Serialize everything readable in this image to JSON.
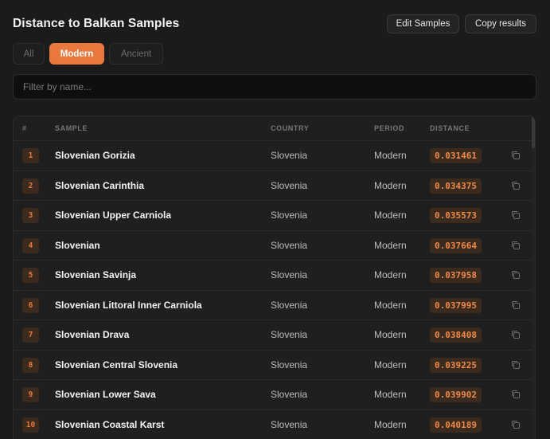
{
  "header": {
    "title": "Distance to Balkan Samples"
  },
  "toolbar": {
    "edit_label": "Edit Samples",
    "copy_label": "Copy results"
  },
  "filters": {
    "all": "All",
    "modern": "Modern",
    "ancient": "Ancient",
    "active": "Modern"
  },
  "search": {
    "placeholder": "Filter by name..."
  },
  "table": {
    "columns": [
      "#",
      "SAMPLE",
      "COUNTRY",
      "PERIOD",
      "DISTANCE"
    ],
    "rows": [
      {
        "rank": "1",
        "sample": "Slovenian Gorizia",
        "country": "Slovenia",
        "period": "Modern",
        "distance": "0.031461"
      },
      {
        "rank": "2",
        "sample": "Slovenian Carinthia",
        "country": "Slovenia",
        "period": "Modern",
        "distance": "0.034375"
      },
      {
        "rank": "3",
        "sample": "Slovenian Upper Carniola",
        "country": "Slovenia",
        "period": "Modern",
        "distance": "0.035573"
      },
      {
        "rank": "4",
        "sample": "Slovenian",
        "country": "Slovenia",
        "period": "Modern",
        "distance": "0.037664"
      },
      {
        "rank": "5",
        "sample": "Slovenian Savinja",
        "country": "Slovenia",
        "period": "Modern",
        "distance": "0.037958"
      },
      {
        "rank": "6",
        "sample": "Slovenian Littoral Inner Carniola",
        "country": "Slovenia",
        "period": "Modern",
        "distance": "0.037995"
      },
      {
        "rank": "7",
        "sample": "Slovenian Drava",
        "country": "Slovenia",
        "period": "Modern",
        "distance": "0.038408"
      },
      {
        "rank": "8",
        "sample": "Slovenian Central Slovenia",
        "country": "Slovenia",
        "period": "Modern",
        "distance": "0.039225"
      },
      {
        "rank": "9",
        "sample": "Slovenian Lower Sava",
        "country": "Slovenia",
        "period": "Modern",
        "distance": "0.039902"
      },
      {
        "rank": "10",
        "sample": "Slovenian Coastal Karst",
        "country": "Slovenia",
        "period": "Modern",
        "distance": "0.040189"
      }
    ],
    "row_icon": "copy-icon"
  },
  "colors": {
    "accent": "#e8783d",
    "background": "#1b1b1b",
    "badge_bg": "#3b2a1e"
  }
}
